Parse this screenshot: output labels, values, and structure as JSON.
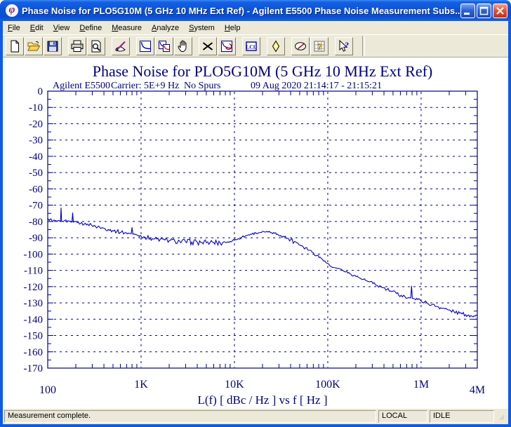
{
  "window": {
    "title": "Phase Noise for PLO5G10M (5 GHz 10 MHz Ext Ref) - Agilent E5500 Phase Noise Measurement Subs...",
    "controls": [
      "minimize",
      "maximize",
      "close"
    ]
  },
  "menu": {
    "items": [
      "File",
      "Edit",
      "View",
      "Define",
      "Measure",
      "Analyze",
      "System",
      "Help"
    ]
  },
  "toolbar": {
    "groups": [
      [
        "new",
        "open",
        "save"
      ],
      [
        "print",
        "print-preview"
      ],
      [
        "annotate"
      ],
      [
        "curve-plot",
        "copy-plots",
        "pan"
      ],
      [
        "delete",
        "replot"
      ],
      [
        "lcl"
      ],
      [
        "sweep-marker"
      ],
      [
        "meter",
        "spur-grid"
      ],
      [
        "context-help"
      ]
    ]
  },
  "chart_header": {
    "instrument": "Agilent E5500",
    "carrier": "Carrier: 5E+9 Hz",
    "spurs": "No Spurs",
    "datetime": "09 Aug 2020  21:14:17 - 21:15:21",
    "text_color": "#000080"
  },
  "chart_data": {
    "type": "line",
    "title": "Phase Noise for PLO5G10M (5 GHz 10 MHz Ext Ref)",
    "xlabel": "L(f) [ dBc / Hz ]  vs  f [ Hz ]",
    "x_scale": "log",
    "x_range": [
      100,
      4000000
    ],
    "y_range": [
      -170,
      0
    ],
    "grid": "dashed",
    "x_ticks": [
      {
        "value": 100,
        "label": "100"
      },
      {
        "value": 1000,
        "label": "1K"
      },
      {
        "value": 10000,
        "label": "10K"
      },
      {
        "value": 100000,
        "label": "100K"
      },
      {
        "value": 1000000,
        "label": "1M"
      },
      {
        "value": 4000000,
        "label": "4M"
      }
    ],
    "y_tick_labels": [
      "0",
      "-10",
      "-20",
      "-30",
      "-40",
      "-50",
      "-60",
      "-70",
      "-80",
      "-90",
      "-100",
      "-110",
      "-120",
      "-130",
      "-140",
      "-150",
      "-160",
      "-170"
    ],
    "series": [
      {
        "name": "phase-noise-trace",
        "color": "#0000cc",
        "units": "dBc/Hz vs Hz",
        "points": [
          [
            100,
            -78.2,
            0.8
          ],
          [
            104,
            -79.3,
            0.8
          ],
          [
            109,
            -78.6,
            0.8
          ],
          [
            114,
            -79.8,
            0.8
          ],
          [
            120,
            -79.4,
            0.8
          ],
          [
            126,
            -80.1,
            0.8
          ],
          [
            132,
            -79.5,
            0.7
          ],
          [
            137,
            -79.8,
            0.2
          ],
          [
            139,
            -71.5,
            0
          ],
          [
            141,
            -79.7,
            0.2
          ],
          [
            146,
            -80.2,
            0.8
          ],
          [
            153,
            -79.3,
            0.8
          ],
          [
            161,
            -80.4,
            0.8
          ],
          [
            170,
            -79.9,
            0.8
          ],
          [
            178,
            -80.4,
            0.5
          ],
          [
            182,
            -80.2,
            0.1
          ],
          [
            185,
            -74.6,
            0
          ],
          [
            188,
            -80.4,
            0.1
          ],
          [
            196,
            -80.1,
            0.8
          ],
          [
            208,
            -80.7,
            0.9
          ],
          [
            225,
            -81.2,
            0.9
          ],
          [
            245,
            -81.7,
            0.9
          ],
          [
            268,
            -81.5,
            0.9
          ],
          [
            295,
            -82.3,
            0.9
          ],
          [
            325,
            -83,
            1.0
          ],
          [
            360,
            -83.6,
            1.0
          ],
          [
            400,
            -84.2,
            1.1
          ],
          [
            445,
            -84.9,
            1.1
          ],
          [
            495,
            -85.5,
            1.1
          ],
          [
            550,
            -86.1,
            1.2
          ],
          [
            610,
            -86.6,
            1.2
          ],
          [
            670,
            -86.9,
            1.2
          ],
          [
            730,
            -87.2,
            1.0
          ],
          [
            785,
            -87.5,
            0.2
          ],
          [
            800,
            -83.6,
            0
          ],
          [
            815,
            -87.7,
            0.2
          ],
          [
            860,
            -88,
            1.0
          ],
          [
            930,
            -88.5,
            1.1
          ],
          [
            1000,
            -89,
            1.2
          ],
          [
            1100,
            -89.6,
            1.3
          ],
          [
            1250,
            -90.2,
            1.4
          ],
          [
            1400,
            -90.7,
            1.4
          ],
          [
            1600,
            -91.1,
            1.5
          ],
          [
            1800,
            -91.4,
            1.5
          ],
          [
            2000,
            -91.7,
            1.6
          ],
          [
            2300,
            -92,
            1.6
          ],
          [
            2600,
            -92.2,
            1.7
          ],
          [
            3000,
            -92.4,
            1.7
          ],
          [
            3500,
            -92.6,
            1.8
          ],
          [
            4000,
            -92.7,
            1.8
          ],
          [
            4500,
            -92.9,
            1.8
          ],
          [
            5000,
            -93,
            1.8
          ],
          [
            5500,
            -92.8,
            1.8
          ],
          [
            6000,
            -92.9,
            1.9
          ],
          [
            6500,
            -93.1,
            1.9
          ],
          [
            7000,
            -93,
            1.9
          ],
          [
            7500,
            -92.9,
            1.8
          ],
          [
            8000,
            -92.7,
            1.8
          ],
          [
            8500,
            -92.5,
            1.7
          ],
          [
            9000,
            -92.2,
            1.5
          ],
          [
            9500,
            -91.9,
            1.3
          ],
          [
            10000,
            -91.5,
            1.0
          ],
          [
            11000,
            -90.5,
            0.8
          ],
          [
            12000,
            -89.7,
            0.8
          ],
          [
            13500,
            -88.6,
            0.7
          ],
          [
            15000,
            -87.8,
            0.7
          ],
          [
            17000,
            -87.1,
            0.7
          ],
          [
            19000,
            -86.7,
            0.6
          ],
          [
            21000,
            -86.4,
            0.6
          ],
          [
            23000,
            -86.5,
            0.6
          ],
          [
            25000,
            -86.9,
            0.6
          ],
          [
            27000,
            -87.3,
            0.7
          ],
          [
            29000,
            -87.9,
            0.8
          ],
          [
            31500,
            -88.6,
            0.9
          ],
          [
            34000,
            -89.4,
            1.1
          ],
          [
            37000,
            -90.3,
            1.3
          ],
          [
            40000,
            -91.2,
            1.4
          ],
          [
            44000,
            -92.3,
            1.5
          ],
          [
            48000,
            -93.4,
            1.5
          ],
          [
            53000,
            -94.8,
            1.4
          ],
          [
            58000,
            -96.1,
            1.3
          ],
          [
            64000,
            -97.7,
            1.2
          ],
          [
            70000,
            -99.2,
            1.1
          ],
          [
            77000,
            -100.8,
            1.0
          ],
          [
            85000,
            -102.6,
            0.9
          ],
          [
            93000,
            -104.2,
            0.7
          ],
          [
            100000,
            -105.7,
            0.5
          ],
          [
            106000,
            -107.4,
            0.3
          ],
          [
            113000,
            -108.2,
            0.25
          ],
          [
            121000,
            -108.5,
            0.25
          ],
          [
            131000,
            -108.8,
            0.3
          ],
          [
            142000,
            -109.7,
            0.4
          ],
          [
            156000,
            -110.9,
            0.5
          ],
          [
            172000,
            -112,
            0.6
          ],
          [
            190000,
            -113.1,
            0.7
          ],
          [
            212000,
            -114.2,
            0.8
          ],
          [
            240000,
            -115.6,
            0.9
          ],
          [
            270000,
            -116.9,
            1.0
          ],
          [
            305000,
            -118.1,
            1.1
          ],
          [
            340000,
            -119.3,
            1.1
          ],
          [
            385000,
            -120.6,
            1.2
          ],
          [
            430000,
            -121.8,
            1.2
          ],
          [
            485000,
            -123,
            1.2
          ],
          [
            545000,
            -124.2,
            1.2
          ],
          [
            610000,
            -125.3,
            1.2
          ],
          [
            670000,
            -126.1,
            1.1
          ],
          [
            730000,
            -126.7,
            0.9
          ],
          [
            775000,
            -126.9,
            0.3
          ],
          [
            790000,
            -119.5,
            0
          ],
          [
            806000,
            -127.2,
            0.3
          ],
          [
            850000,
            -127.5,
            0.9
          ],
          [
            920000,
            -127.9,
            1.0
          ],
          [
            1000000,
            -128.6,
            1.0
          ],
          [
            1150000,
            -129.9,
            1.1
          ],
          [
            1300000,
            -131.1,
            1.1
          ],
          [
            1500000,
            -132.3,
            1.1
          ],
          [
            1700000,
            -133.2,
            1.1
          ],
          [
            1950000,
            -134.3,
            1.1
          ],
          [
            2250000,
            -135.4,
            1.1
          ],
          [
            2600000,
            -136.3,
            1.1
          ],
          [
            3000000,
            -137.2,
            1.1
          ],
          [
            3400000,
            -137.8,
            1.1
          ],
          [
            3700000,
            -137.9,
            1.0
          ],
          [
            3880000,
            -137.4,
            0.9
          ],
          [
            4000000,
            -137.7,
            0.8
          ]
        ]
      }
    ]
  },
  "status_bar": {
    "message": "Measurement complete.",
    "panels": [
      {
        "label": "LOCAL"
      },
      {
        "label": "IDLE"
      }
    ]
  }
}
